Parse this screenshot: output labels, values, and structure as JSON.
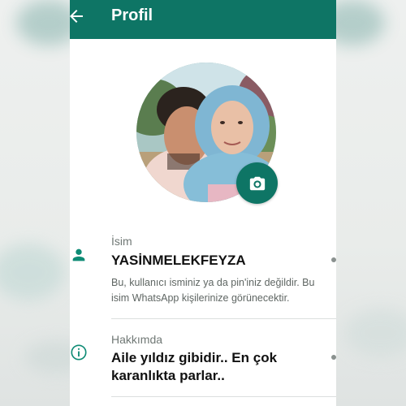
{
  "header": {
    "title": "Profil",
    "color": "#0e7565"
  },
  "icons": {
    "back": "arrow-left-icon",
    "camera": "camera-icon",
    "name": "person-icon",
    "about": "info-icon"
  },
  "name_section": {
    "label": "İsim",
    "value": "YASİNMELEKFEYZA",
    "hint": "Bu, kullanıcı isminiz ya da pin'iniz değildir. Bu isim WhatsApp kişilerinize görünecektir."
  },
  "about_section": {
    "label": "Hakkımda",
    "value": "Aile yıldız gibidir.. En çok karanlıkta parlar.."
  }
}
